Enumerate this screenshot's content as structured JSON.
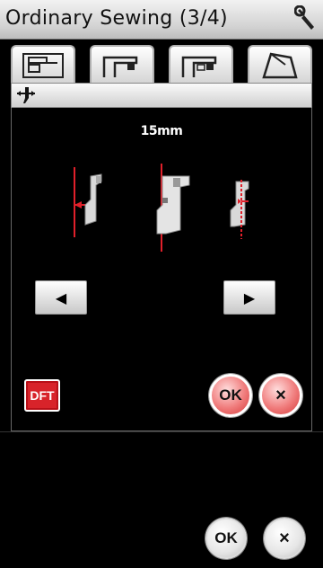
{
  "title": "Ordinary Sewing (3/4)",
  "icons": {
    "settings": "wrench-icon",
    "panel_header": "foot-adjust-icon"
  },
  "tabs": [
    {
      "name": "tab-sewing-1",
      "icon": "machine-icon-1"
    },
    {
      "name": "tab-sewing-2",
      "icon": "machine-icon-2"
    },
    {
      "name": "tab-sewing-3",
      "icon": "machine-icon-3"
    },
    {
      "name": "tab-sewing-4",
      "icon": "bag-icon"
    }
  ],
  "panel": {
    "value_label": "15mm",
    "left_button_glyph": "◀",
    "right_button_glyph": "▶",
    "default_button_label": "DFT",
    "ok_label": "OK",
    "cancel_label": "×"
  },
  "footer": {
    "ok_label": "OK",
    "cancel_label": "×"
  },
  "colors": {
    "accent_red": "#d8232a",
    "guide_line": "#e0202a"
  }
}
